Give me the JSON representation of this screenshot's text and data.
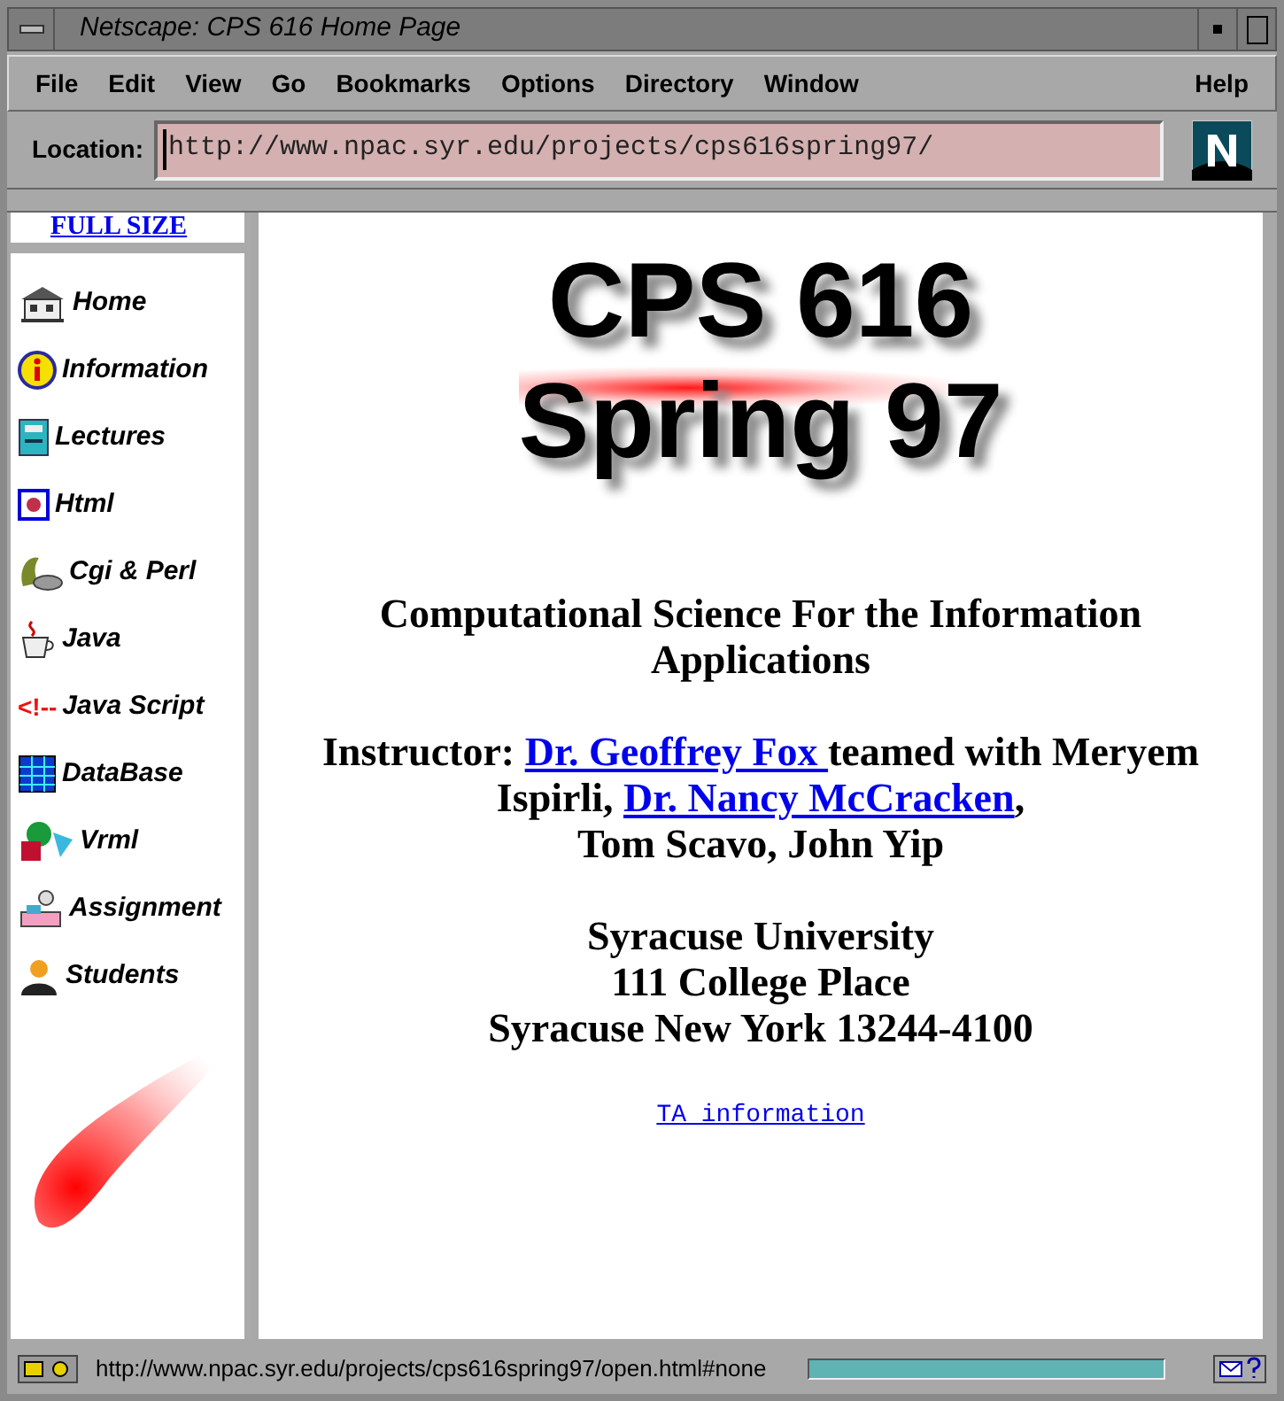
{
  "window": {
    "title": "Netscape: CPS 616 Home Page"
  },
  "menu": [
    "File",
    "Edit",
    "View",
    "Go",
    "Bookmarks",
    "Options",
    "Directory",
    "Window"
  ],
  "menu_right": "Help",
  "location": {
    "label": "Location:",
    "value": "http://www.npac.syr.edu/projects/cps616spring97/"
  },
  "sidebar": {
    "full_size_link": "FULL SIZE",
    "items": [
      {
        "label": "Home",
        "kind": "house"
      },
      {
        "label": "Information",
        "kind": "info"
      },
      {
        "label": "Lectures",
        "kind": "book"
      },
      {
        "label": "Html",
        "kind": "frame"
      },
      {
        "label": "Cgi & Perl",
        "kind": "shell"
      },
      {
        "label": "Java",
        "kind": "cup"
      },
      {
        "label": "Java Script",
        "kind": "comment",
        "mark": "<!--"
      },
      {
        "label": "DataBase",
        "kind": "grid"
      },
      {
        "label": "Vrml",
        "kind": "shapes"
      },
      {
        "label": "Assignment",
        "kind": "desk"
      },
      {
        "label": "Students",
        "kind": "person"
      }
    ]
  },
  "main": {
    "banner": [
      "CPS 616",
      "Spring 97"
    ],
    "subtitle": "Computational Science For the Information Applications",
    "instructors": [
      [
        {
          "kind": "text",
          "text": "Instructor: "
        },
        {
          "kind": "link",
          "text": "Dr. Geoffrey Fox "
        },
        {
          "kind": "text",
          "text": "teamed with Meryem"
        }
      ],
      [
        {
          "kind": "text",
          "text": "Ispirli, "
        },
        {
          "kind": "link",
          "text": "Dr. Nancy McCracken"
        },
        {
          "kind": "text",
          "text": ","
        }
      ],
      [
        {
          "kind": "text",
          "text": "Tom Scavo, John Yip"
        }
      ]
    ],
    "address": [
      "Syracuse University",
      "111 College Place",
      "Syracuse New York 13244-4100"
    ],
    "ta_link": "TA information"
  },
  "status_bar": {
    "url": "http://www.npac.syr.edu/projects/cps616spring97/open.html#none",
    "progress": {
      "level": 1
    }
  }
}
